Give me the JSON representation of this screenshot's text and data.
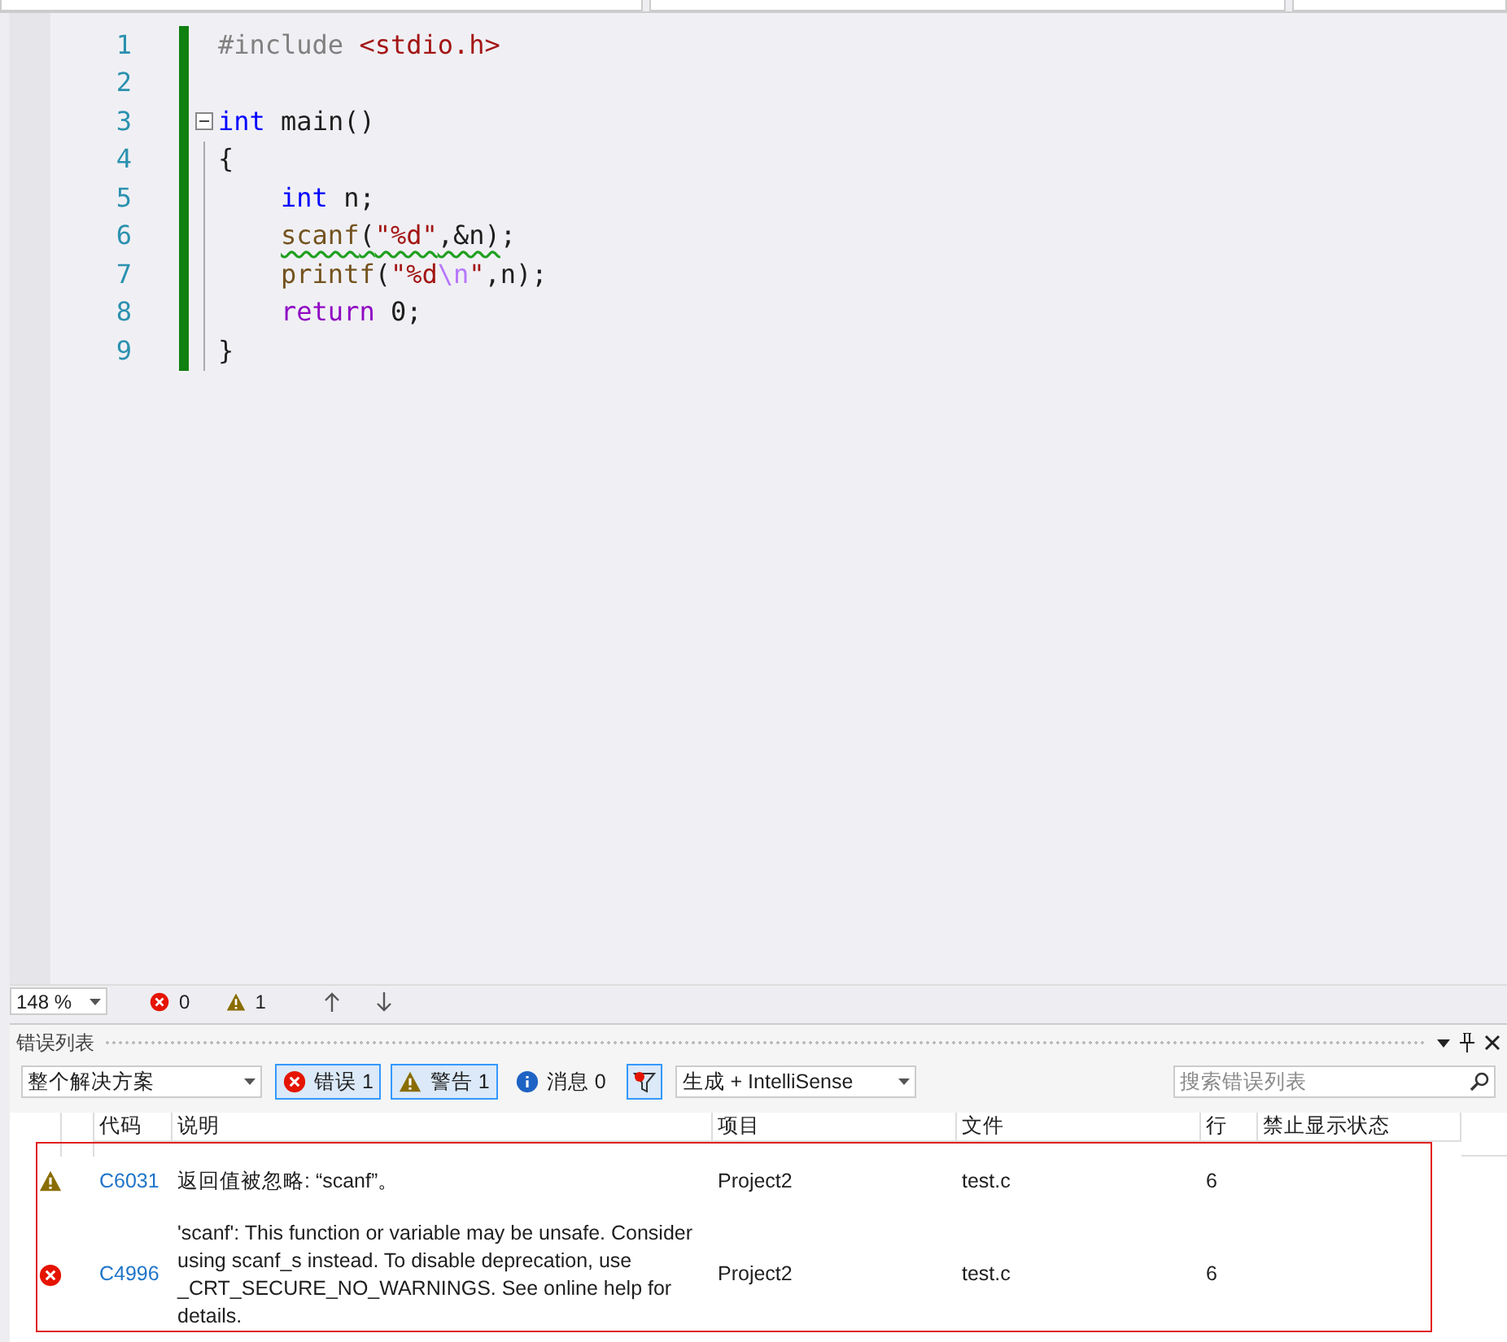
{
  "editor": {
    "lines": [
      {
        "number": "1",
        "tokens": [
          {
            "kind": "preproc",
            "text": "#include "
          },
          {
            "kind": "string",
            "text": "<stdio.h>"
          }
        ]
      },
      {
        "number": "2"
      },
      {
        "number": "3",
        "fold": {
          "expanded": true
        },
        "tokens": [
          {
            "kind": "keyword",
            "text": "int"
          },
          {
            "kind": "plain",
            "text": " main()"
          }
        ]
      },
      {
        "number": "4",
        "tokens": [
          {
            "kind": "plain",
            "text": "{"
          }
        ]
      },
      {
        "number": "5",
        "tokens": [
          {
            "kind": "keyword",
            "text": "    int"
          },
          {
            "kind": "plain",
            "text": " n;"
          }
        ]
      },
      {
        "number": "6",
        "tokens": [
          {
            "kind": "function",
            "text": "    scanf",
            "squiggle": true
          },
          {
            "kind": "plain",
            "text": "(",
            "squiggle": true
          },
          {
            "kind": "string",
            "text": "\"%d\"",
            "squiggle": true
          },
          {
            "kind": "plain",
            "text": ",&n)",
            "squiggle": true
          },
          {
            "kind": "plain",
            "text": ";"
          }
        ]
      },
      {
        "number": "7",
        "tokens": [
          {
            "kind": "function",
            "text": "    printf"
          },
          {
            "kind": "plain",
            "text": "("
          },
          {
            "kind": "string",
            "text": "\"%d"
          },
          {
            "kind": "escape",
            "text": "\\n"
          },
          {
            "kind": "string",
            "text": "\""
          },
          {
            "kind": "plain",
            "text": ",n);"
          }
        ]
      },
      {
        "number": "8",
        "tokens": [
          {
            "kind": "control",
            "text": "    return"
          },
          {
            "kind": "plain",
            "text": " 0;"
          }
        ]
      },
      {
        "number": "9",
        "tokens": [
          {
            "kind": "plain",
            "text": "}"
          }
        ]
      }
    ]
  },
  "status_bar": {
    "zoom": "148 %",
    "errors": "0",
    "warnings": "1"
  },
  "error_list": {
    "title": "错误列表",
    "scope": "整个解决方案",
    "filters": [
      {
        "kind": "error",
        "label": "错误 1",
        "selected": true
      },
      {
        "kind": "warning",
        "label": "警告 1",
        "selected": true
      },
      {
        "kind": "info",
        "label": "消息 0",
        "selected": false
      }
    ],
    "source": "生成 + IntelliSense",
    "search": {
      "placeholder": "搜索错误列表"
    },
    "columns": [
      "代码",
      "说明",
      "项目",
      "文件",
      "行",
      "禁止显示状态"
    ],
    "rows": [
      {
        "kind": "warning",
        "code": "C6031",
        "description": "返回值被忽略: “scanf”。",
        "project": "Project2",
        "file": "test.c",
        "line": "6"
      },
      {
        "kind": "error",
        "code": "C4996",
        "description": "'scanf': This function or variable may be unsafe. Consider using scanf_s instead. To disable deprecation, use _CRT_SECURE_NO_WARNINGS. See online help for details.",
        "project": "Project2",
        "file": "test.c",
        "line": "6"
      }
    ]
  }
}
